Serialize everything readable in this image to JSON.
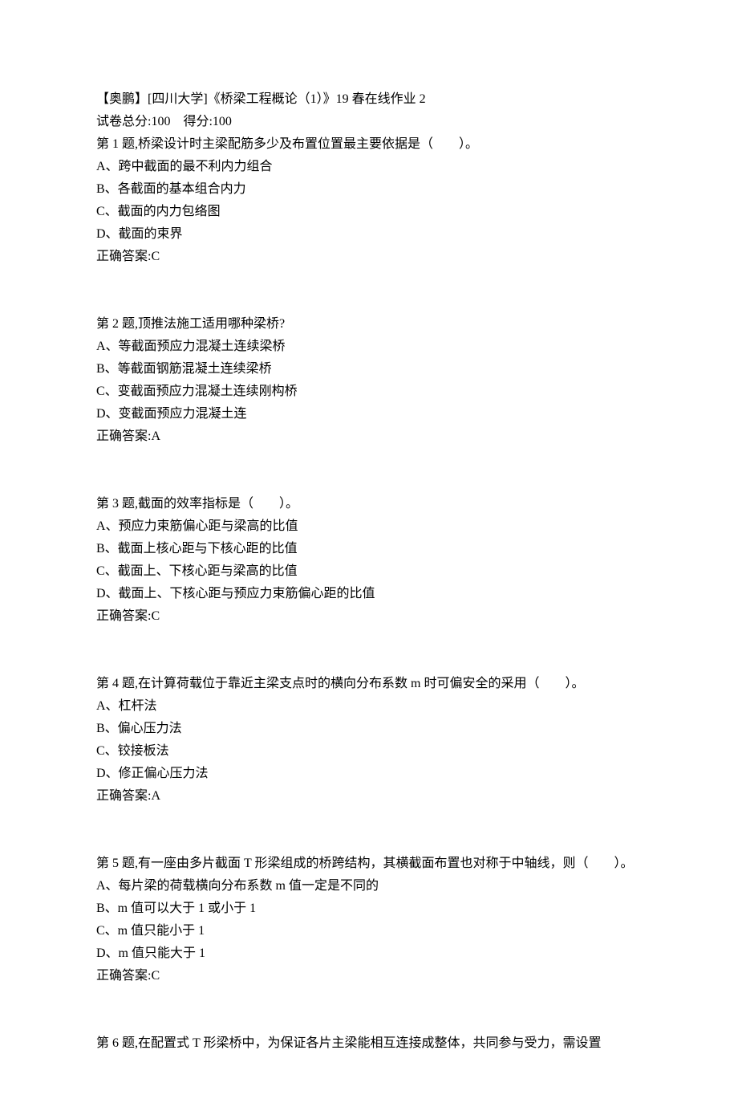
{
  "header": {
    "title": "【奥鹏】[四川大学]《桥梁工程概论（1）》19 春在线作业 2",
    "score_prefix": "试卷总分:",
    "total_score": "100",
    "score_gap": "    ",
    "obtained_prefix": "得分:",
    "obtained_score": "100"
  },
  "questions": [
    {
      "stem": "第 1 题,桥梁设计时主梁配筋多少及布置位置最主要依据是（　　）。",
      "options": [
        "A、跨中截面的最不利内力组合",
        "B、各截面的基本组合内力",
        "C、截面的内力包络图",
        "D、截面的束界"
      ],
      "answer_label": "正确答案:",
      "answer": "C"
    },
    {
      "stem": "第 2 题,顶推法施工适用哪种梁桥?",
      "options": [
        "A、等截面预应力混凝土连续梁桥",
        "B、等截面钢筋混凝土连续梁桥",
        "C、变截面预应力混凝土连续刚构桥",
        "D、变截面预应力混凝土连"
      ],
      "answer_label": "正确答案:",
      "answer": "A"
    },
    {
      "stem": "第 3 题,截面的效率指标是（　　）。",
      "options": [
        "A、预应力束筋偏心距与梁高的比值",
        "B、截面上核心距与下核心距的比值",
        "C、截面上、下核心距与梁高的比值",
        "D、截面上、下核心距与预应力束筋偏心距的比值"
      ],
      "answer_label": "正确答案:",
      "answer": "C"
    },
    {
      "stem": "第 4 题,在计算荷载位于靠近主梁支点时的横向分布系数 m 时可偏安全的采用（　　）。",
      "options": [
        "A、杠杆法",
        "B、偏心压力法",
        "C、铰接板法",
        "D、修正偏心压力法"
      ],
      "answer_label": "正确答案:",
      "answer": "A"
    },
    {
      "stem": "第 5 题,有一座由多片截面 T 形梁组成的桥跨结构，其横截面布置也对称于中轴线，则（　　）。",
      "options": [
        "A、每片梁的荷载横向分布系数 m 值一定是不同的",
        "B、m 值可以大于 1 或小于 1",
        "C、m 值只能小于 1",
        "D、m 值只能大于 1"
      ],
      "answer_label": "正确答案:",
      "answer": "C"
    },
    {
      "stem": "第 6 题,在配置式 T 形梁桥中，为保证各片主梁能相互连接成整体，共同参与受力，需设置",
      "options": [],
      "answer_label": "",
      "answer": ""
    }
  ]
}
